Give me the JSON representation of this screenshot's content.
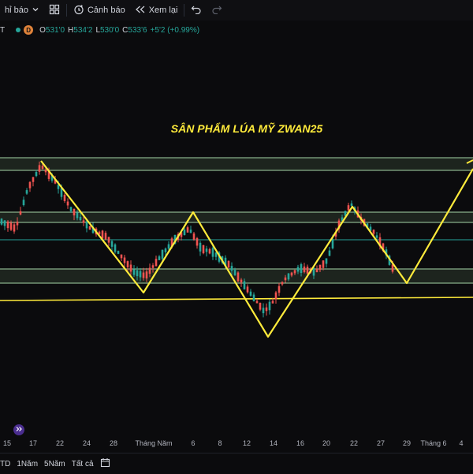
{
  "toolbar": {
    "indicators_label": "hỉ báo",
    "alert_label": "Cảnh báo",
    "replay_label": "Xem lại"
  },
  "legend": {
    "symbol": "T",
    "interval": "D",
    "open_key": "O",
    "open": "531'0",
    "high_key": "H",
    "high": "534'2",
    "low_key": "L",
    "low": "530'0",
    "close_key": "C",
    "close": "533'6",
    "change": "+5'2 (+0.99%)"
  },
  "annotation": {
    "title": "SÂN PHẨM LÚA MỸ ZWAN25",
    "color": "#ffeb3b"
  },
  "colors": {
    "up": "#26a69a",
    "down": "#ef5350",
    "zone": "#2e3b2e",
    "zone_line": "#a5d6a7",
    "pattern": "#ffeb3b",
    "mid_line": "#26a69a"
  },
  "time_axis": {
    "ticks": [
      {
        "label": "15"
      },
      {
        "label": "17"
      },
      {
        "label": "22"
      },
      {
        "label": "24"
      },
      {
        "label": "28"
      },
      {
        "label": "Tháng Năm"
      },
      {
        "label": "6"
      },
      {
        "label": "8"
      },
      {
        "label": "12"
      },
      {
        "label": "14"
      },
      {
        "label": "16"
      },
      {
        "label": "20"
      },
      {
        "label": "22"
      },
      {
        "label": "27"
      },
      {
        "label": "29"
      },
      {
        "label": "Tháng 6"
      },
      {
        "label": "4"
      }
    ]
  },
  "range_bar": {
    "items": [
      {
        "label": "TD"
      },
      {
        "label": "1Năm"
      },
      {
        "label": "5Năm"
      },
      {
        "label": "Tất cả"
      }
    ]
  }
}
